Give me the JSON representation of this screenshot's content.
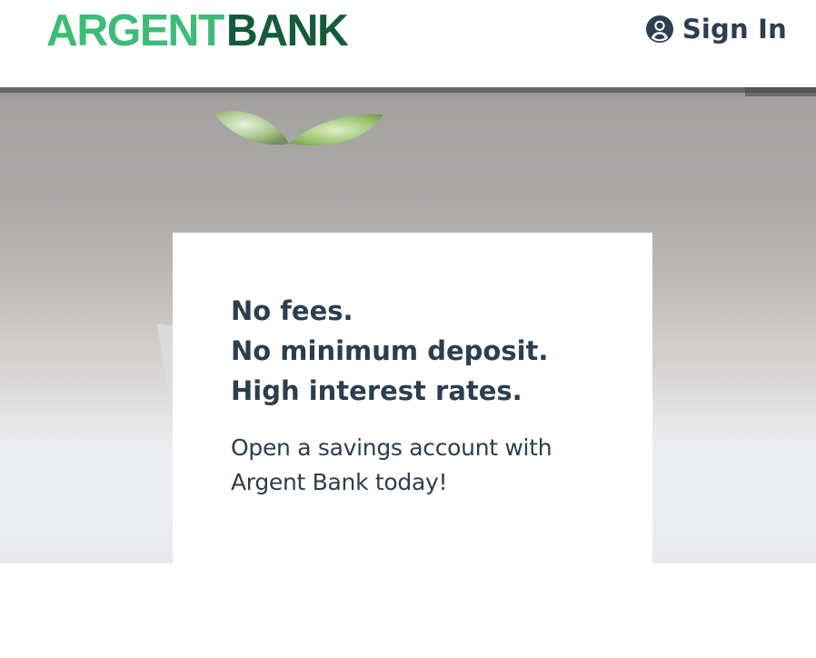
{
  "header": {
    "logo_part1": "ARGENT",
    "logo_part2": "BANK",
    "signin_label": "Sign In",
    "signin_icon": "user-circle-icon"
  },
  "hero": {
    "headline_lines": [
      "No fees.",
      "No minimum deposit.",
      "High interest rates."
    ],
    "subtitle": "Open a savings account with Argent Bank today!"
  },
  "colors": {
    "logo_light_green": "#3dbc78",
    "logo_dark_green": "#135c3a",
    "text_dark": "#2c3e50",
    "card_background": "#ffffff"
  }
}
